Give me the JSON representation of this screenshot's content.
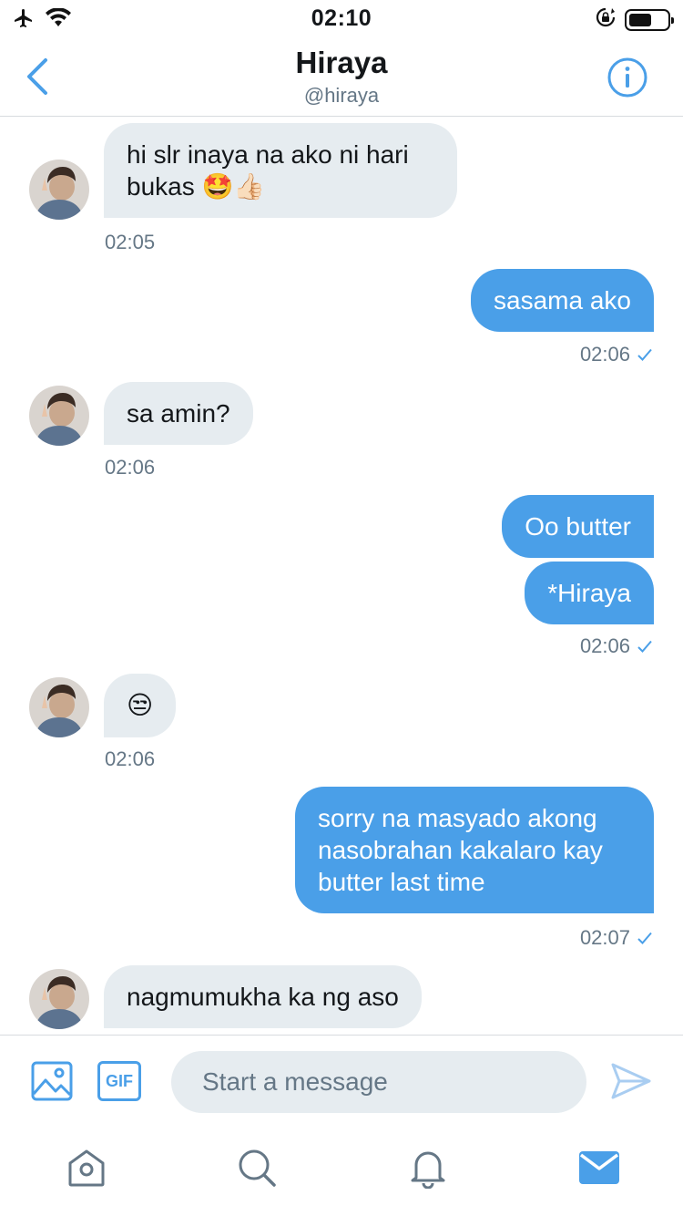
{
  "status_bar": {
    "time": "02:10"
  },
  "header": {
    "title": "Hiraya",
    "handle": "@hiraya"
  },
  "messages": [
    {
      "side": "in",
      "text": "hi slr inaya na ako ni hari bukas 🤩👍🏻",
      "time": "02:05"
    },
    {
      "side": "out",
      "text": "sasama ako",
      "time": "02:06"
    },
    {
      "side": "in",
      "text": "sa amin?",
      "time": "02:06"
    },
    {
      "side": "out",
      "text": "Oo butter"
    },
    {
      "side": "out",
      "text": "*Hiraya",
      "time": "02:06"
    },
    {
      "side": "in",
      "text": "😒",
      "time": "02:06"
    },
    {
      "side": "out",
      "text": "sorry na masyado akong nasobrahan kakalaro kay butter last time",
      "time": "02:07"
    },
    {
      "side": "in",
      "text": "nagmumukha ka ng aso"
    }
  ],
  "composer": {
    "placeholder": "Start a message",
    "gif_label": "GIF"
  },
  "colors": {
    "accent": "#4a9fe8",
    "incoming_bubble": "#e6ecf0",
    "secondary_text": "#657786"
  },
  "icons": {
    "status": [
      "airplane-icon",
      "wifi-icon",
      "orientation-lock-icon",
      "battery-icon"
    ],
    "header": [
      "back-chevron-icon",
      "info-icon"
    ],
    "composer": [
      "image-icon",
      "gif-icon",
      "send-icon"
    ],
    "tabbar": [
      "home-icon",
      "search-icon",
      "notifications-icon",
      "messages-icon"
    ]
  },
  "battery_level": 0.6
}
